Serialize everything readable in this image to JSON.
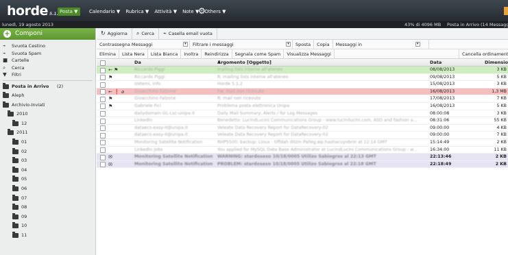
{
  "topbar": {
    "logo": "horde",
    "version": "5.1.2",
    "active_app": "Posta ▼",
    "menu": [
      "Calendario ▼",
      "Rubrica ▼",
      "Attività ▼",
      "Note ▼",
      "Others ▼"
    ],
    "settings_icon": "gear-icon"
  },
  "infobar": {
    "date": "lunedì, 19 agosto 2013",
    "quota": "43% di 4096 MB",
    "status": "Posta in Arrivo (14 Messaggi)"
  },
  "sidebar": {
    "compose": "Componi",
    "actions": [
      {
        "label": "Svuota Cestino",
        "icon": "broom-icon"
      },
      {
        "label": "Svuota Spam",
        "icon": "broom-icon"
      },
      {
        "label": "Cartelle",
        "icon": "folder-icon"
      },
      {
        "label": "Cerca",
        "icon": "search-icon"
      },
      {
        "label": "Filtri",
        "icon": "filter-icon"
      }
    ],
    "folders": [
      {
        "name": "Posta in Arrivo",
        "count": "(2)",
        "level": 0,
        "icon": "inbox-icon"
      },
      {
        "name": "Aleph",
        "level": 0
      },
      {
        "name": "Archivio-Inviati",
        "level": 0
      },
      {
        "name": "2010",
        "level": 1
      },
      {
        "name": "12",
        "level": 2
      },
      {
        "name": "2011",
        "level": 1
      },
      {
        "name": "01",
        "level": 2
      },
      {
        "name": "02",
        "level": 2
      },
      {
        "name": "03",
        "level": 2
      },
      {
        "name": "04",
        "level": 2
      },
      {
        "name": "05",
        "level": 2
      },
      {
        "name": "06",
        "level": 2
      },
      {
        "name": "07",
        "level": 2
      },
      {
        "name": "08",
        "level": 2
      },
      {
        "name": "09",
        "level": 2
      },
      {
        "name": "10",
        "level": 2
      },
      {
        "name": "11",
        "level": 2
      }
    ]
  },
  "toolbar1": {
    "refresh": "Aggiorna",
    "search": "Cerca",
    "empty_mailbox": "Casella email vuota"
  },
  "toolbar2": {
    "mark": "Contrassegna Messaggi",
    "filter": "Filtrare i messaggi",
    "move": "Sposta",
    "copy": "Copia",
    "messages_in": "Messaggi in"
  },
  "toolbar3": {
    "buttons": [
      "Elimina",
      "Lista Nera",
      "Lista Bianca",
      "Inoltra",
      "Reindirizza",
      "Segnala come Spam",
      "Visualizza Messaggi"
    ],
    "sort": "Cancella ordinamento"
  },
  "columns": {
    "from": "Da",
    "subject": "Argomento [Oggetto]",
    "date": "Data",
    "size": "Dimensione"
  },
  "messages": [
    {
      "style": "green",
      "bold": false,
      "icons": "← ⚑",
      "from": "Riccardo Piggi",
      "subject": "mailing lists interne all'ateneo",
      "date": "08/08/2013",
      "size": "3 KB"
    },
    {
      "style": "",
      "bold": false,
      "icons": "⚑",
      "from": "Riccardo Piggi",
      "subject": "R: mailing lists interne all'ateneo",
      "date": "09/08/2013",
      "size": "5 KB"
    },
    {
      "style": "",
      "bold": false,
      "icons": "",
      "from": "sistemi, info",
      "subject": "Horde 5.1.2",
      "date": "15/08/2013",
      "size": "3 KB"
    },
    {
      "style": "red",
      "bold": false,
      "icons": "← ❗ ⌀",
      "from": "Gioacchino Falzone",
      "subject": "Fw: mail non ricevute",
      "date": "16/08/2013",
      "size": "1,3 MB"
    },
    {
      "style": "",
      "bold": false,
      "icons": "⚑",
      "from": "Gioacchino Falzone",
      "subject": "R: mail non ricevute",
      "date": "17/08/2013",
      "size": "7 KB"
    },
    {
      "style": "",
      "bold": false,
      "icons": "⚑",
      "from": "Gabriele Fici",
      "subject": "Problema posta elettronica Unipa",
      "date": "16/08/2013",
      "size": "5 KB"
    },
    {
      "style": "",
      "bold": false,
      "icons": "",
      "from": "dailydomain-GL-Lsc-unipa.it",
      "subject": "Daily Mail Summary: Alerts / for Log Messages",
      "date": "08:00:08",
      "size": "3 KB"
    },
    {
      "style": "",
      "bold": false,
      "icons": "",
      "from": "LinkedIn",
      "subject": "Benedetto: LucindLucini Communications Group - www.lucinilucini.com, ASD and fashion a...",
      "date": "08:31:06",
      "size": "55 KB"
    },
    {
      "style": "",
      "bold": false,
      "icons": "",
      "from": "dataeco.easy-II@unipa.it",
      "subject": "Veleate Data Recovery Report for DataRecovery-02",
      "date": "09:00:00",
      "size": "4 KB"
    },
    {
      "style": "",
      "bold": false,
      "icons": "",
      "from": "dataeco.easy-II@unipa.it",
      "subject": "Veleate Data Recovery Report for DataRecovery-02",
      "date": "09:00:00",
      "size": "7 KB"
    },
    {
      "style": "",
      "bold": false,
      "icons": "",
      "from": "Monitoring Satellite Notification",
      "subject": "RHP5500: backup: Linux - tiffdah ditzin Palleg.wp.hashacuyobrin at 12:14 GMT",
      "date": "15:14:49",
      "size": "2 KB"
    },
    {
      "style": "",
      "bold": false,
      "icons": "",
      "from": "LinkedIn Jobs",
      "subject": "You applied for MySQL Data Base Administrator at LucindLucini Communications Group - w...",
      "date": "16:34:00",
      "size": "11 KB"
    },
    {
      "style": "purple",
      "bold": true,
      "icons": "✉",
      "from": "Monitoring Satellite Notification",
      "subject": "WARNING: stardosexo 10/18/0005 Utilizo Sabiogrox al 22:13 GMT",
      "date": "22:13:46",
      "size": "2 KB"
    },
    {
      "style": "purple",
      "bold": true,
      "icons": "✉",
      "from": "Monitoring Satellite Notification",
      "subject": "PROBLEM: stardosexo 10/18/0005 Utilizo Sabiogrox al 22:18 GMT",
      "date": "22:18:49",
      "size": "2 KB"
    }
  ]
}
